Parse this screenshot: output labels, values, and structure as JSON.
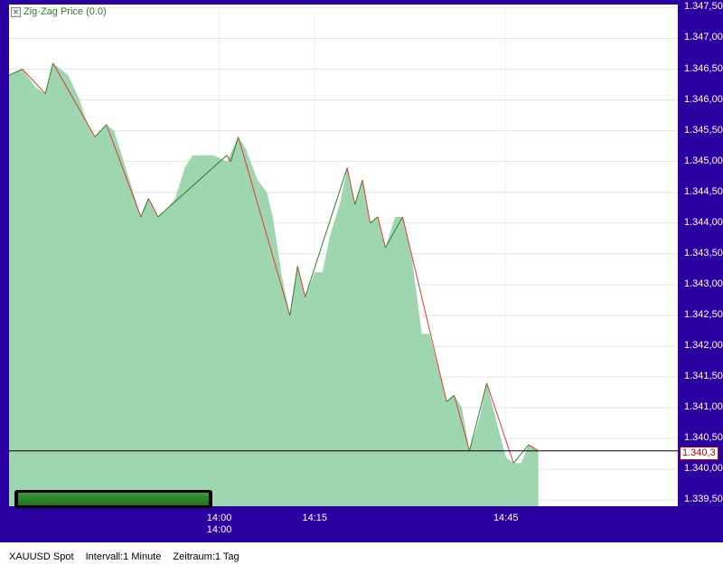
{
  "chart_data": {
    "type": "area",
    "legend": {
      "label": "Zig-Zag Price (0.0)",
      "close_glyph": "✕"
    },
    "y_tick_labels": [
      "1.347,50",
      "1.347,00",
      "1.346,50",
      "1.346,00",
      "1.345,50",
      "1.345,00",
      "1.344,50",
      "1.344,00",
      "1.343,50",
      "1.343,00",
      "1.342,50",
      "1.342,00",
      "1.341,50",
      "1.341,00",
      "1.340,50",
      "1.340,00",
      "1.339,50"
    ],
    "ylim": [
      1339.4,
      1347.55
    ],
    "xlim": [
      13.45,
      15.2
    ],
    "x_ticks": [
      {
        "x": 14.0,
        "label": "14:00",
        "sublabel": "14:00"
      },
      {
        "x": 14.25,
        "label": "14:15",
        "sublabel": ""
      },
      {
        "x": 14.75,
        "label": "14:45",
        "sublabel": ""
      }
    ],
    "grid": true,
    "colors": {
      "area": "#9dd6af",
      "zigzag_up": "#2e7d32",
      "zigzag_down": "#e53935",
      "frame": "#2a00a0",
      "lastline": "#000000"
    },
    "price_series": {
      "name": "XAUUSD Spot",
      "points": [
        [
          13.45,
          1346.4
        ],
        [
          13.485,
          1346.5
        ],
        [
          13.52,
          1346.2
        ],
        [
          13.545,
          1346.1
        ],
        [
          13.565,
          1346.6
        ],
        [
          13.605,
          1346.4
        ],
        [
          13.635,
          1346.0
        ],
        [
          13.655,
          1345.6
        ],
        [
          13.675,
          1345.4
        ],
        [
          13.705,
          1345.6
        ],
        [
          13.725,
          1345.5
        ],
        [
          13.76,
          1344.8
        ],
        [
          13.795,
          1344.1
        ],
        [
          13.815,
          1344.4
        ],
        [
          13.84,
          1344.1
        ],
        [
          13.86,
          1344.2
        ],
        [
          13.885,
          1344.4
        ],
        [
          13.91,
          1344.9
        ],
        [
          13.93,
          1345.1
        ],
        [
          13.985,
          1345.1
        ],
        [
          14.02,
          1345.0
        ],
        [
          14.05,
          1345.4
        ],
        [
          14.07,
          1345.2
        ],
        [
          14.1,
          1344.7
        ],
        [
          14.125,
          1344.5
        ],
        [
          14.14,
          1344.1
        ],
        [
          14.165,
          1343.1
        ],
        [
          14.185,
          1342.5
        ],
        [
          14.205,
          1343.3
        ],
        [
          14.225,
          1342.8
        ],
        [
          14.25,
          1343.2
        ],
        [
          14.27,
          1343.2
        ],
        [
          14.29,
          1343.8
        ],
        [
          14.315,
          1344.3
        ],
        [
          14.335,
          1344.9
        ],
        [
          14.355,
          1344.3
        ],
        [
          14.375,
          1344.7
        ],
        [
          14.395,
          1344.0
        ],
        [
          14.415,
          1344.1
        ],
        [
          14.435,
          1343.6
        ],
        [
          14.46,
          1344.1
        ],
        [
          14.48,
          1344.1
        ],
        [
          14.505,
          1343.4
        ],
        [
          14.53,
          1342.2
        ],
        [
          14.55,
          1342.2
        ],
        [
          14.575,
          1341.6
        ],
        [
          14.595,
          1341.1
        ],
        [
          14.615,
          1341.2
        ],
        [
          14.635,
          1341.0
        ],
        [
          14.655,
          1340.3
        ],
        [
          14.68,
          1340.8
        ],
        [
          14.7,
          1341.4
        ],
        [
          14.725,
          1340.8
        ],
        [
          14.75,
          1340.2
        ],
        [
          14.77,
          1340.1
        ],
        [
          14.79,
          1340.1
        ],
        [
          14.81,
          1340.4
        ],
        [
          14.835,
          1340.3
        ],
        [
          14.835,
          1339.4
        ]
      ]
    },
    "zigzag": {
      "name": "Zig-Zag Price (0.0)",
      "points": [
        [
          13.45,
          1346.4
        ],
        [
          13.485,
          1346.5
        ],
        [
          13.545,
          1346.1
        ],
        [
          13.565,
          1346.6
        ],
        [
          13.675,
          1345.4
        ],
        [
          13.705,
          1345.6
        ],
        [
          13.795,
          1344.1
        ],
        [
          13.815,
          1344.4
        ],
        [
          13.84,
          1344.1
        ],
        [
          14.02,
          1345.1
        ],
        [
          14.03,
          1345.0
        ],
        [
          14.05,
          1345.4
        ],
        [
          14.185,
          1342.5
        ],
        [
          14.205,
          1343.3
        ],
        [
          14.225,
          1342.8
        ],
        [
          14.335,
          1344.9
        ],
        [
          14.355,
          1344.3
        ],
        [
          14.375,
          1344.7
        ],
        [
          14.395,
          1344.0
        ],
        [
          14.415,
          1344.1
        ],
        [
          14.435,
          1343.6
        ],
        [
          14.48,
          1344.1
        ],
        [
          14.595,
          1341.1
        ],
        [
          14.615,
          1341.2
        ],
        [
          14.655,
          1340.3
        ],
        [
          14.7,
          1341.4
        ],
        [
          14.77,
          1340.1
        ],
        [
          14.81,
          1340.4
        ],
        [
          14.835,
          1340.3
        ]
      ]
    },
    "last_price": {
      "value": 1340.3,
      "label": "1.340,3"
    }
  },
  "footer": {
    "symbol": "XAUUSD Spot",
    "interval": "Intervall:1 Minute",
    "range": "Zeitraum:1 Tag"
  }
}
